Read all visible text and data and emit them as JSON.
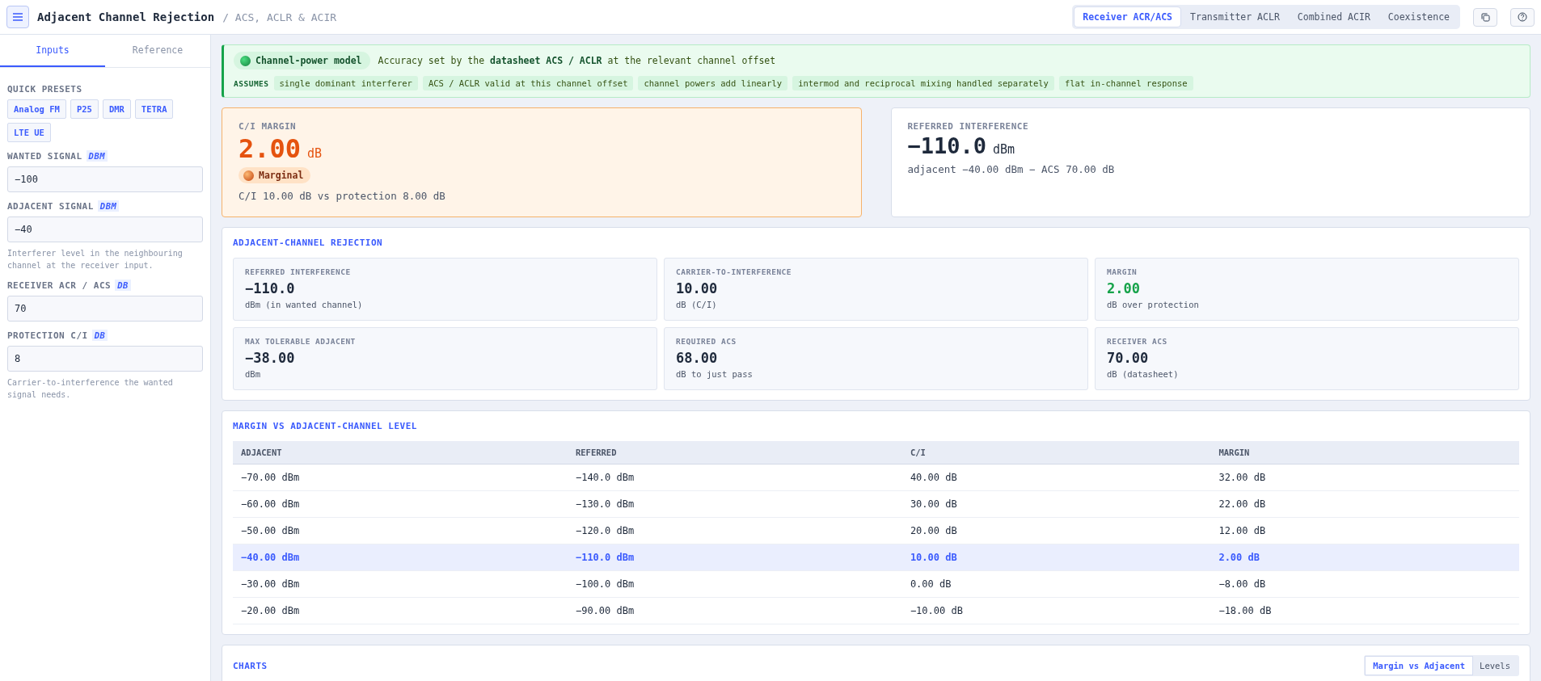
{
  "header": {
    "title": "Adjacent Channel Rejection",
    "subtitle": "/ ACS, ACLR & ACIR",
    "modes": [
      {
        "label": "Receiver ACR/ACS",
        "selected": true
      },
      {
        "label": "Transmitter ACLR",
        "selected": false
      },
      {
        "label": "Combined ACIR",
        "selected": false
      },
      {
        "label": "Coexistence",
        "selected": false
      }
    ]
  },
  "sidebar": {
    "tabs": [
      {
        "label": "Inputs",
        "selected": true
      },
      {
        "label": "Reference",
        "selected": false
      }
    ],
    "presets_label": "QUICK PRESETS",
    "presets": [
      "Analog FM",
      "P25",
      "DMR",
      "TETRA",
      "LTE UE"
    ],
    "fields": [
      {
        "label": "WANTED SIGNAL",
        "unit": "DBM",
        "value": "−100"
      },
      {
        "label": "ADJACENT SIGNAL",
        "unit": "DBM",
        "value": "−40",
        "hint": "Interferer level in the neighbouring channel at the receiver input."
      },
      {
        "label": "RECEIVER ACR / ACS",
        "unit": "DB",
        "value": "70"
      },
      {
        "label": "PROTECTION C/I",
        "unit": "DB",
        "value": "8",
        "hint": "Carrier-to-interference the wanted signal needs."
      }
    ]
  },
  "banner": {
    "badge": "Channel-power model",
    "text": "Accuracy set by the **datasheet ACS / ACLR** at the relevant channel offset",
    "assumes_label": "ASSUMES",
    "assumptions": [
      "single dominant interferer",
      "ACS / ACLR valid at this channel offset",
      "channel powers add linearly",
      "intermod and reciprocal mixing handled separately",
      "flat in-channel response"
    ]
  },
  "margin_card": {
    "label": "C/I MARGIN",
    "value": "2.00",
    "unit": "dB",
    "kind": "warning",
    "status": "Marginal",
    "detail": "C/I 10.00 dB vs protection 8.00 dB"
  },
  "referred_card": {
    "label": "REFERRED INTERFERENCE",
    "value": "−110.0",
    "unit": "dBm",
    "detail": "adjacent −40.00 dBm − ACS 70.00 dB"
  },
  "rejection": {
    "title": "ADJACENT-CHANNEL REJECTION",
    "tiles": [
      {
        "label": "REFERRED INTERFERENCE",
        "value": "−110.0",
        "sub": "dBm (in wanted channel)",
        "kind": "plain"
      },
      {
        "label": "CARRIER-TO-INTERFERENCE",
        "value": "10.00",
        "sub": "dB (C/I)",
        "kind": "plain"
      },
      {
        "label": "MARGIN",
        "value": "2.00",
        "sub": "dB over protection",
        "kind": "positive"
      },
      {
        "label": "MAX TOLERABLE ADJACENT",
        "value": "−38.00",
        "sub": "dBm",
        "kind": "plain"
      },
      {
        "label": "REQUIRED ACS",
        "value": "68.00",
        "sub": "dB to just pass",
        "kind": "plain"
      },
      {
        "label": "RECEIVER ACS",
        "value": "70.00",
        "sub": "dB (datasheet)",
        "kind": "plain"
      }
    ]
  },
  "table": {
    "title": "MARGIN VS ADJACENT-CHANNEL LEVEL",
    "columns": [
      "ADJACENT",
      "REFERRED",
      "C/I",
      "MARGIN"
    ],
    "rows": [
      {
        "cells": [
          "−70.00 dBm",
          "−140.0 dBm",
          "40.00 dB",
          "32.00 dB"
        ],
        "selected": false
      },
      {
        "cells": [
          "−60.00 dBm",
          "−130.0 dBm",
          "30.00 dB",
          "22.00 dB"
        ],
        "selected": false
      },
      {
        "cells": [
          "−50.00 dBm",
          "−120.0 dBm",
          "20.00 dB",
          "12.00 dB"
        ],
        "selected": false
      },
      {
        "cells": [
          "−40.00 dBm",
          "−110.0 dBm",
          "10.00 dB",
          "2.00 dB"
        ],
        "selected": true
      },
      {
        "cells": [
          "−30.00 dBm",
          "−100.0 dBm",
          "0.00 dB",
          "−8.00 dB"
        ],
        "selected": false
      },
      {
        "cells": [
          "−20.00 dBm",
          "−90.00 dBm",
          "−10.00 dB",
          "−18.00 dB"
        ],
        "selected": false
      }
    ]
  },
  "charts": {
    "title": "CHARTS",
    "tabs": [
      {
        "label": "Margin vs Adjacent",
        "selected": true
      },
      {
        "label": "Levels",
        "selected": false
      }
    ]
  }
}
